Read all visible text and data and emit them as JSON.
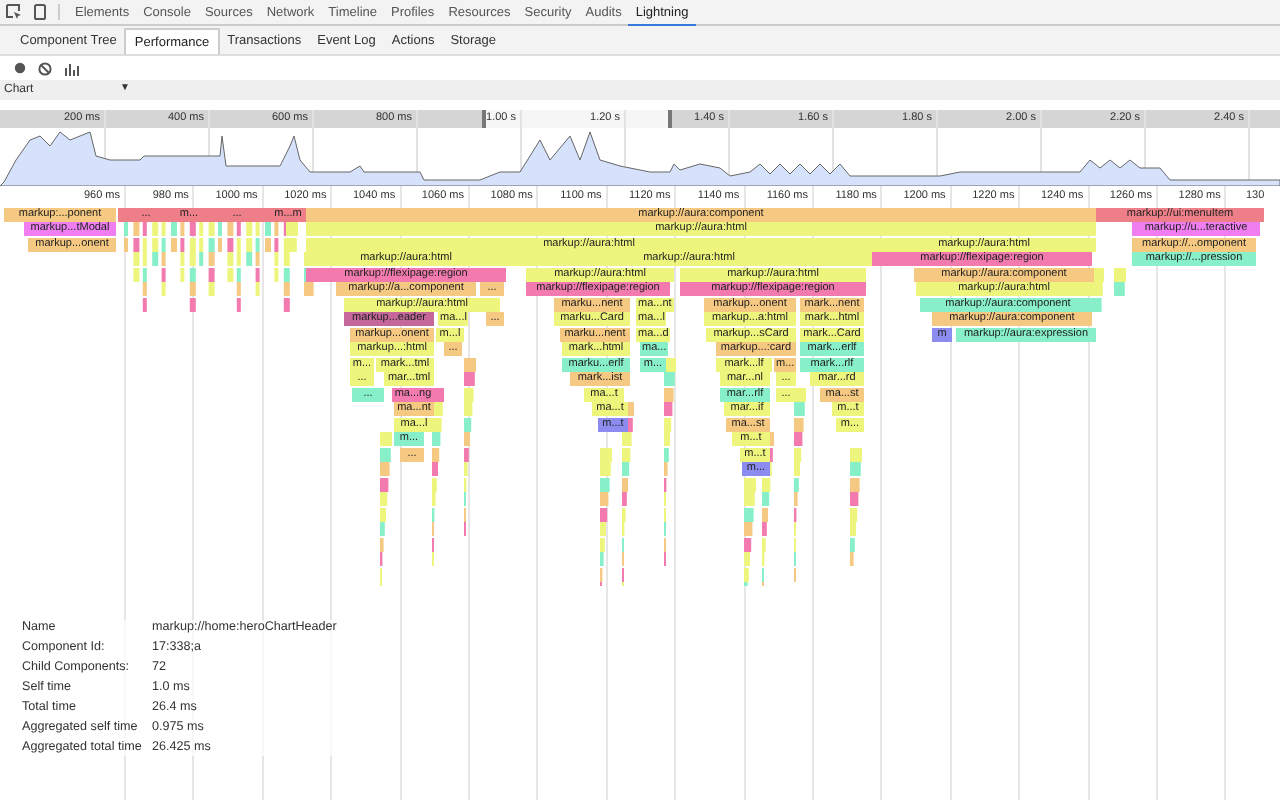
{
  "devtools_tabs": [
    {
      "label": "Elements",
      "selected": false
    },
    {
      "label": "Console",
      "selected": false
    },
    {
      "label": "Sources",
      "selected": false
    },
    {
      "label": "Network",
      "selected": false
    },
    {
      "label": "Timeline",
      "selected": false
    },
    {
      "label": "Profiles",
      "selected": false
    },
    {
      "label": "Resources",
      "selected": false
    },
    {
      "label": "Security",
      "selected": false
    },
    {
      "label": "Audits",
      "selected": false
    },
    {
      "label": "Lightning",
      "selected": true
    }
  ],
  "sub_tabs": [
    {
      "label": "Component Tree",
      "selected": false
    },
    {
      "label": "Performance",
      "selected": true
    },
    {
      "label": "Transactions",
      "selected": false
    },
    {
      "label": "Event Log",
      "selected": false
    },
    {
      "label": "Actions",
      "selected": false
    },
    {
      "label": "Storage",
      "selected": false
    }
  ],
  "view_select": {
    "value": "Chart",
    "arrow": "▼"
  },
  "overview": {
    "ticks": [
      "200 ms",
      "400 ms",
      "600 ms",
      "800 ms",
      "1.00 s",
      "1.20 s",
      "1.40 s",
      "1.60 s",
      "1.80 s",
      "2.00 s",
      "2.20 s",
      "2.40 s"
    ]
  },
  "flame_chart": {
    "ticks": [
      "960 ms",
      "980 ms",
      "1000 ms",
      "1020 ms",
      "1040 ms",
      "1060 ms",
      "1080 ms",
      "1100 ms",
      "1120 ms",
      "1140 ms",
      "1160 ms",
      "1180 ms",
      "1200 ms",
      "1220 ms",
      "1240 ms",
      "1260 ms",
      "1280 ms",
      "130"
    ],
    "levels": [
      [
        {
          "label": "markup:...ponent",
          "color": "#f6c982"
        },
        {
          "label": "...",
          "color": "#ee7f88"
        },
        {
          "label": "m...",
          "color": "#ee7f88"
        },
        {
          "label": "...",
          "color": "#ee7f88"
        },
        {
          "label": "m...m",
          "color": "#ee7f88"
        },
        {
          "label": "markup://aura:component",
          "color": "#f6c982"
        },
        {
          "label": "markup://ui:menuItem",
          "color": "#ee7f88"
        }
      ],
      [
        {
          "label": "markup...tModal",
          "color": "#f07ef0"
        },
        {
          "label": "markup://aura:html",
          "color": "#eef57c"
        },
        {
          "label": "markup://u...teractive",
          "color": "#f07ef0"
        }
      ],
      [
        {
          "label": "markup...onent",
          "color": "#f6c982"
        },
        {
          "label": "markup://aura:html",
          "color": "#eef57c"
        },
        {
          "label": "markup://aura:html",
          "color": "#eef57c"
        },
        {
          "label": "markup://...omponent",
          "color": "#f6c982"
        }
      ],
      [
        {
          "label": "markup://aura:html",
          "color": "#eef57c"
        },
        {
          "label": "markup://aura:html",
          "color": "#eef57c"
        },
        {
          "label": "markup://flexipage:region",
          "color": "#f27aae"
        },
        {
          "label": "markup://...pression",
          "color": "#87f0c9"
        }
      ],
      [
        {
          "label": "markup://flexipage:region",
          "color": "#f27aae"
        },
        {
          "label": "markup://aura:html",
          "color": "#eef57c"
        },
        {
          "label": "markup://aura:html",
          "color": "#eef57c"
        },
        {
          "label": "markup://aura:component",
          "color": "#f6c982"
        }
      ],
      [
        {
          "label": "markup://a...component",
          "color": "#f6c982"
        },
        {
          "label": "...",
          "color": "#f6c982"
        },
        {
          "label": "markup://flexipage:region",
          "color": "#f27aae"
        },
        {
          "label": "markup://flexipage:region",
          "color": "#f27aae"
        },
        {
          "label": "markup://aura:html",
          "color": "#eef57c"
        }
      ],
      [
        {
          "label": "markup://aura:html",
          "color": "#eef57c"
        },
        {
          "label": "marku...nent",
          "color": "#f6c982"
        },
        {
          "label": "ma...nt",
          "color": "#eef57c"
        },
        {
          "label": "markup...onent",
          "color": "#f6c982"
        },
        {
          "label": "mark...nent",
          "color": "#f6c982"
        },
        {
          "label": "markup://aura:component",
          "color": "#87f0c9"
        }
      ],
      [
        {
          "label": "markup...eader",
          "color": "#c5679a"
        },
        {
          "label": "ma...l",
          "color": "#eef57c"
        },
        {
          "label": "...",
          "color": "#f6c982"
        },
        {
          "label": "marku...Card",
          "color": "#eef57c"
        },
        {
          "label": "ma...l",
          "color": "#eef57c"
        },
        {
          "label": "markup...a:html",
          "color": "#eef57c"
        },
        {
          "label": "mark...html",
          "color": "#eef57c"
        },
        {
          "label": "markup://aura:component",
          "color": "#f6c982"
        }
      ],
      [
        {
          "label": "markup...onent",
          "color": "#f6c982"
        },
        {
          "label": "m...l",
          "color": "#eef57c"
        },
        {
          "label": "marku...nent",
          "color": "#f6c982"
        },
        {
          "label": "ma...d",
          "color": "#eef57c"
        },
        {
          "label": "markup...sCard",
          "color": "#eef57c"
        },
        {
          "label": "mark...Card",
          "color": "#eef57c"
        },
        {
          "label": "m",
          "color": "#8c8cf0"
        },
        {
          "label": "markup://aura:expression",
          "color": "#87f0c9"
        }
      ],
      [
        {
          "label": "markup...:html",
          "color": "#eef57c"
        },
        {
          "label": "...",
          "color": "#f6c982"
        },
        {
          "label": "mark...html",
          "color": "#eef57c"
        },
        {
          "label": "ma...",
          "color": "#87f0c9"
        },
        {
          "label": "markup...:card",
          "color": "#f6c982"
        },
        {
          "label": "mark...erlf",
          "color": "#87f0c9"
        }
      ],
      [
        {
          "label": "m...",
          "color": "#eef57c"
        },
        {
          "label": "mark...tml",
          "color": "#eef57c"
        },
        {
          "label": "marku...erlf",
          "color": "#87f0c9"
        },
        {
          "label": "m...",
          "color": "#87f0c9"
        },
        {
          "label": "mark...lf",
          "color": "#eef57c"
        },
        {
          "label": "m...",
          "color": "#f6c982"
        },
        {
          "label": "mark...rlf",
          "color": "#87f0c9"
        }
      ],
      [
        {
          "label": "...",
          "color": "#eef57c"
        },
        {
          "label": "mar...tml",
          "color": "#eef57c"
        },
        {
          "label": "mark...ist",
          "color": "#f6c982"
        },
        {
          "label": "mar...nl",
          "color": "#eef57c"
        },
        {
          "label": "...",
          "color": "#eef57c"
        },
        {
          "label": "mar...rd",
          "color": "#eef57c"
        }
      ],
      [
        {
          "label": "...",
          "color": "#87f0c9"
        },
        {
          "label": "ma...ng",
          "color": "#f27aae"
        },
        {
          "label": "ma...t",
          "color": "#eef57c"
        },
        {
          "label": "mar...rlf",
          "color": "#87f0c9"
        },
        {
          "label": "...",
          "color": "#eef57c"
        },
        {
          "label": "ma...st",
          "color": "#f6c982"
        }
      ],
      [
        {
          "label": "ma...nt",
          "color": "#f6c982"
        },
        {
          "label": "ma...t",
          "color": "#eef57c"
        },
        {
          "label": "mar...if",
          "color": "#eef57c"
        },
        {
          "label": "m...t",
          "color": "#eef57c"
        }
      ],
      [
        {
          "label": "ma...l",
          "color": "#eef57c"
        },
        {
          "label": "m...t",
          "color": "#8c8cf0"
        },
        {
          "label": "ma...st",
          "color": "#f6c982"
        },
        {
          "label": "m...",
          "color": "#eef57c"
        }
      ],
      [
        {
          "label": "m...",
          "color": "#87f0c9"
        },
        {
          "label": "m...t",
          "color": "#eef57c"
        }
      ],
      [
        {
          "label": "...",
          "color": "#f6c982"
        },
        {
          "label": "m...t",
          "color": "#eef57c"
        }
      ],
      [
        {
          "label": "m...",
          "color": "#8c8cf0"
        }
      ]
    ]
  },
  "details": [
    {
      "key": "Name",
      "value": "markup://home:heroChartHeader"
    },
    {
      "key": "Component Id:",
      "value": "17:338;a"
    },
    {
      "key": "Child Components:",
      "value": "72"
    },
    {
      "key": "Self time",
      "value": "1.0 ms"
    },
    {
      "key": "Total time",
      "value": "26.4 ms"
    },
    {
      "key": "Aggregated self time",
      "value": "0.975 ms"
    },
    {
      "key": "Aggregated total time",
      "value": "26.425 ms"
    }
  ]
}
